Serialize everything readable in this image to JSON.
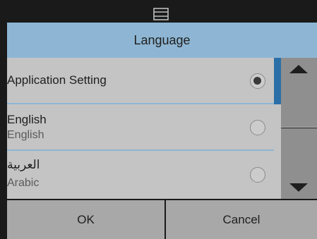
{
  "status": {
    "icon": "window-icon",
    "trailing_text": "("
  },
  "header": {
    "title": "Language"
  },
  "language_list": {
    "items": [
      {
        "primary": "Application Setting",
        "secondary": "",
        "selected": true
      },
      {
        "primary": "English",
        "secondary": "English",
        "selected": false
      },
      {
        "primary": "العربية",
        "secondary": "Arabic",
        "selected": false
      }
    ]
  },
  "scroll": {
    "up_icon": "arrow-up-icon",
    "down_icon": "arrow-down-icon"
  },
  "buttons": {
    "ok_label": "OK",
    "cancel_label": "Cancel"
  },
  "colors": {
    "header_background": "#8eb6d4",
    "list_background": "#c4c4c4",
    "scroll_indicator": "#2b6fa8",
    "scroll_button": "#8f8f8f",
    "bottom_button": "#a8a8a8"
  }
}
